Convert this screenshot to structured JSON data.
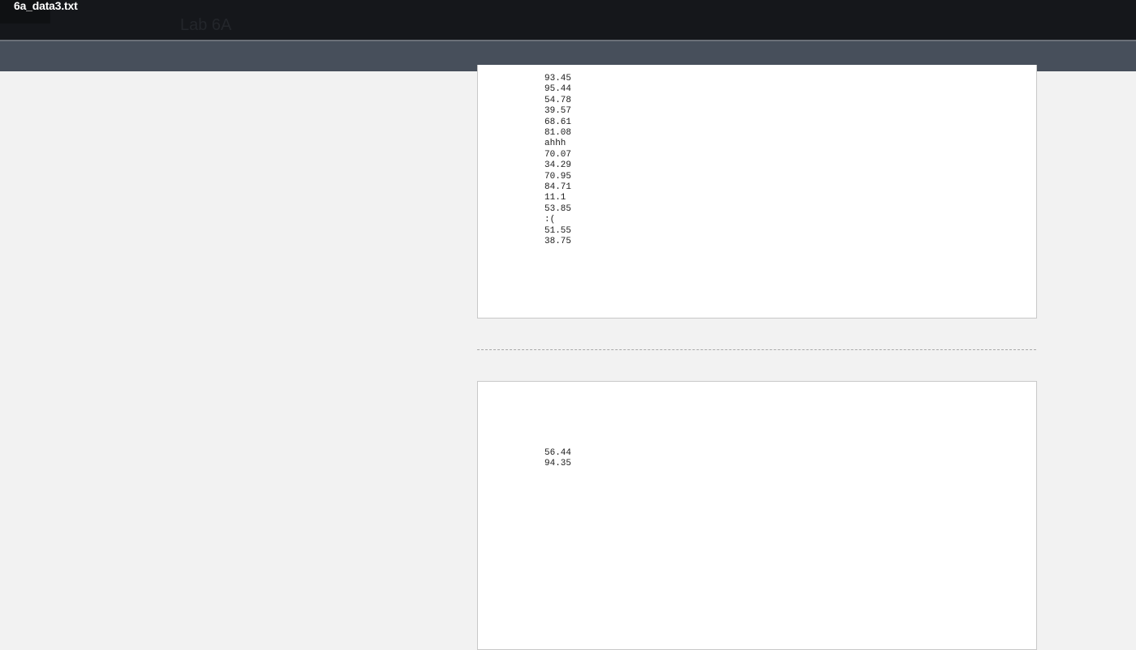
{
  "window": {
    "file_title": "6a_data3.txt",
    "page_heading": "Lab 6A"
  },
  "panels": {
    "top": {
      "lines": [
        "93.45",
        "95.44",
        "54.78",
        "39.57",
        "68.61",
        "81.08",
        "ahhh",
        "70.07",
        "34.29",
        "70.95",
        "84.71",
        "11.1",
        "53.85",
        ":(",
        "51.55",
        "38.75"
      ]
    },
    "bottom": {
      "lines": [
        "56.44",
        "94.35"
      ]
    }
  },
  "colors": {
    "title_bar": "#15171b",
    "toolbar": "#474f5b",
    "page_background": "#f2f2f2",
    "panel_background": "#ffffff"
  }
}
